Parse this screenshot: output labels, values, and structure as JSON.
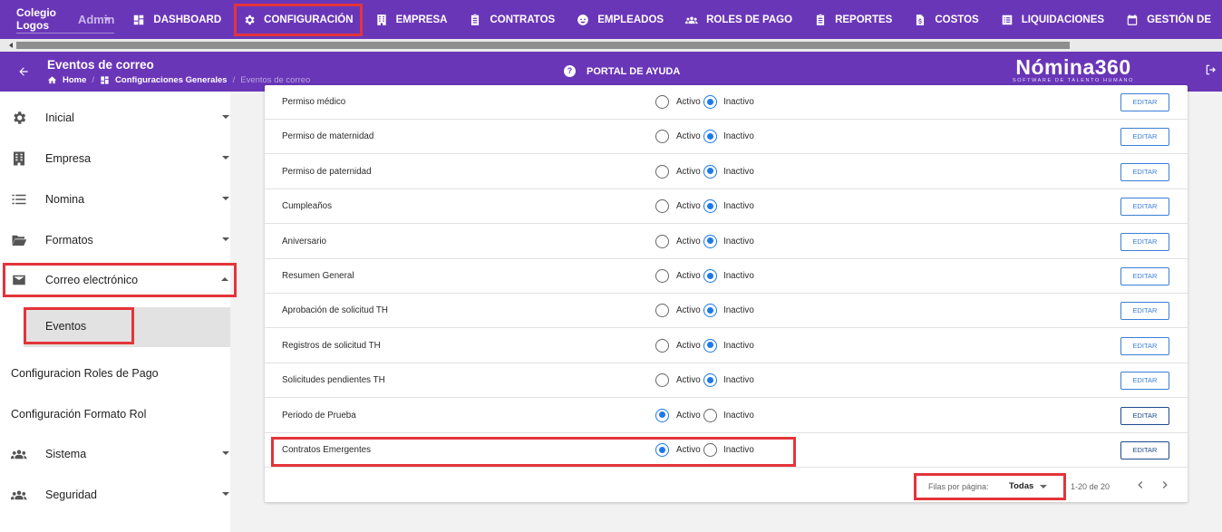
{
  "topbar": {
    "org_name": "Colegio Logos",
    "role": "Admin",
    "nav": [
      {
        "label": "DASHBOARD",
        "icon": "dashboard-icon"
      },
      {
        "label": "CONFIGURACIÓN",
        "icon": "gear-icon"
      },
      {
        "label": "EMPRESA",
        "icon": "building-icon"
      },
      {
        "label": "CONTRATOS",
        "icon": "clipboard-icon"
      },
      {
        "label": "EMPLEADOS",
        "icon": "face-icon"
      },
      {
        "label": "ROLES DE PAGO",
        "icon": "group-icon"
      },
      {
        "label": "REPORTES",
        "icon": "clipboard-icon"
      },
      {
        "label": "COSTOS",
        "icon": "document-dollar-icon"
      },
      {
        "label": "LIQUIDACIONES",
        "icon": "list-icon"
      },
      {
        "label": "GESTIÓN DE",
        "icon": "calendar-icon"
      }
    ]
  },
  "header": {
    "title": "Eventos de correo",
    "breadcrumb": [
      "Home",
      "Configuraciones Generales",
      "Eventos de correo"
    ],
    "help_label": "PORTAL DE AYUDA",
    "brand_name": "Nómina360",
    "brand_tagline": "SOFTWARE DE TALENTO HUMANO"
  },
  "sidebar": {
    "items": [
      {
        "label": "Inicial",
        "icon": "gear-icon"
      },
      {
        "label": "Empresa",
        "icon": "building-icon"
      },
      {
        "label": "Nomina",
        "icon": "list-icon"
      },
      {
        "label": "Formatos",
        "icon": "folder-open-icon"
      },
      {
        "label": "Correo electrónico",
        "icon": "mail-icon"
      },
      {
        "label": "Configuracion Roles de Pago"
      },
      {
        "label": "Configuración Formato Rol"
      },
      {
        "label": "Sistema",
        "icon": "group-icon"
      },
      {
        "label": "Seguridad",
        "icon": "group-icon"
      }
    ],
    "sub_item": "Eventos"
  },
  "events": {
    "active_label": "Activo",
    "inactive_label": "Inactivo",
    "edit_label": "EDITAR",
    "rows": [
      {
        "name": "Permiso médico",
        "status": "Inactivo"
      },
      {
        "name": "Permiso de maternidad",
        "status": "Inactivo"
      },
      {
        "name": "Permiso de paternidad",
        "status": "Inactivo"
      },
      {
        "name": "Cumpleaños",
        "status": "Inactivo"
      },
      {
        "name": "Aniversario",
        "status": "Inactivo"
      },
      {
        "name": "Resumen General",
        "status": "Inactivo"
      },
      {
        "name": "Aprobación de solicitud TH",
        "status": "Inactivo"
      },
      {
        "name": "Registros de solicitud TH",
        "status": "Inactivo"
      },
      {
        "name": "Solicitudes pendientes TH",
        "status": "Inactivo"
      },
      {
        "name": "Periodo de Prueba",
        "status": "Activo"
      },
      {
        "name": "Contratos Emergentes",
        "status": "Activo"
      }
    ]
  },
  "pagination": {
    "rows_per_page_label": "Filas por página:",
    "rows_per_page_value": "Todas",
    "range": "1-20 de 20"
  },
  "colors": {
    "primary": "#6a36b8",
    "radio_selected": "#1e78e8",
    "highlight": "#e3343a"
  }
}
